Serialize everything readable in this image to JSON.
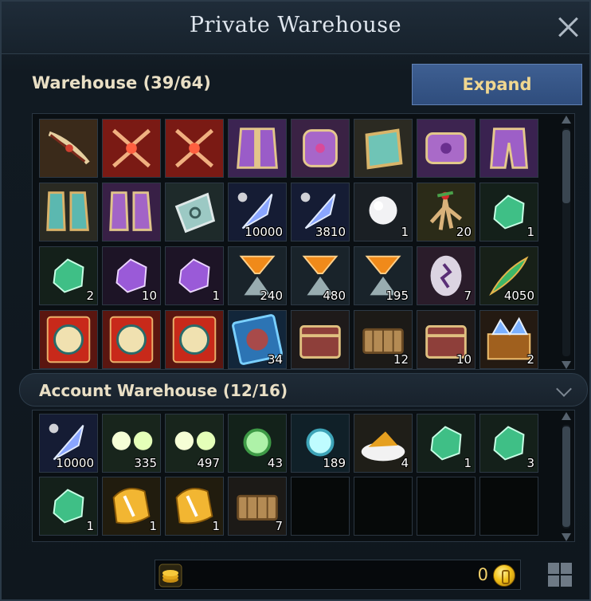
{
  "window": {
    "title": "Private Warehouse"
  },
  "warehouse": {
    "title": "Warehouse (39/64)",
    "expand_label": "Expand",
    "items": [
      {
        "icon": "bow",
        "qty": ""
      },
      {
        "icon": "red-crest-armor",
        "qty": ""
      },
      {
        "icon": "red-crest-armor",
        "qty": ""
      },
      {
        "icon": "purple-robe",
        "qty": ""
      },
      {
        "icon": "purple-gloves",
        "qty": ""
      },
      {
        "icon": "teal-bracer",
        "qty": ""
      },
      {
        "icon": "purple-belt",
        "qty": ""
      },
      {
        "icon": "purple-leggings",
        "qty": ""
      },
      {
        "icon": "teal-boots",
        "qty": ""
      },
      {
        "icon": "purple-boots",
        "qty": ""
      },
      {
        "icon": "silver-charm",
        "qty": ""
      },
      {
        "icon": "blue-crystal-shard",
        "qty": "10000"
      },
      {
        "icon": "blue-crystal-shard",
        "qty": "3810"
      },
      {
        "icon": "pearl",
        "qty": "1"
      },
      {
        "icon": "ginseng-root",
        "qty": "20"
      },
      {
        "icon": "green-ore",
        "qty": "1"
      },
      {
        "icon": "green-ore",
        "qty": "2"
      },
      {
        "icon": "purple-ore",
        "qty": "10"
      },
      {
        "icon": "purple-ore",
        "qty": "1"
      },
      {
        "icon": "orange-sand-funnel",
        "qty": "240"
      },
      {
        "icon": "orange-sand-funnel",
        "qty": "480"
      },
      {
        "icon": "orange-sand-funnel",
        "qty": "195"
      },
      {
        "icon": "rune-stone",
        "qty": "7"
      },
      {
        "icon": "green-feather",
        "qty": "4050"
      },
      {
        "icon": "red-seal-card",
        "qty": ""
      },
      {
        "icon": "red-seal-card",
        "qty": ""
      },
      {
        "icon": "red-seal-card",
        "qty": ""
      },
      {
        "icon": "blue-seal-card",
        "qty": "34"
      },
      {
        "icon": "red-treasure-chest",
        "qty": ""
      },
      {
        "icon": "wooden-chest",
        "qty": "12"
      },
      {
        "icon": "red-treasure-chest",
        "qty": "10"
      },
      {
        "icon": "blue-gem-chest",
        "qty": "2"
      }
    ]
  },
  "account_warehouse": {
    "title": "Account Warehouse (12/16)",
    "items": [
      {
        "icon": "blue-crystal-shard",
        "qty": "10000"
      },
      {
        "icon": "glowing-orbs",
        "qty": "335"
      },
      {
        "icon": "glowing-orbs",
        "qty": "497"
      },
      {
        "icon": "green-sparkle-gem",
        "qty": "43"
      },
      {
        "icon": "cyan-sparkle-gem",
        "qty": "189"
      },
      {
        "icon": "golden-food-plate",
        "qty": "4"
      },
      {
        "icon": "green-ore",
        "qty": "1"
      },
      {
        "icon": "green-ore",
        "qty": "3"
      },
      {
        "icon": "green-ore",
        "qty": "1"
      },
      {
        "icon": "golden-scroll",
        "qty": "1"
      },
      {
        "icon": "golden-scroll",
        "qty": "1"
      },
      {
        "icon": "wooden-chest",
        "qty": "7"
      },
      {
        "icon": "empty",
        "qty": ""
      },
      {
        "icon": "empty",
        "qty": ""
      },
      {
        "icon": "empty",
        "qty": ""
      },
      {
        "icon": "empty",
        "qty": ""
      }
    ]
  },
  "currency": {
    "value": "0",
    "icon": "gold-coin-icon"
  },
  "colors": {
    "accent_button": "#34548a",
    "button_text": "#f0d790",
    "header_text": "#e9dfc5"
  }
}
